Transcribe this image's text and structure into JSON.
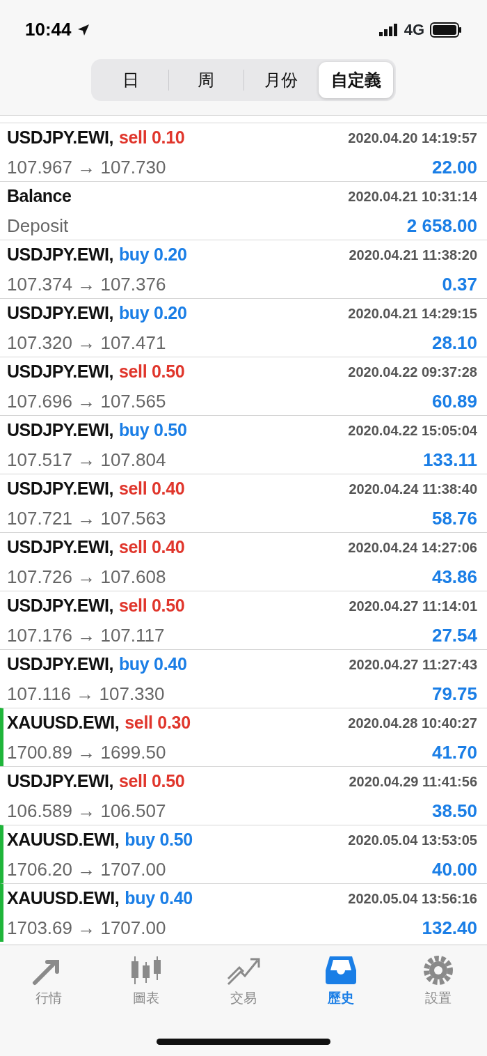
{
  "status_bar": {
    "time": "10:44",
    "network": "4G"
  },
  "segments": [
    {
      "label": "日",
      "selected": false
    },
    {
      "label": "周",
      "selected": false
    },
    {
      "label": "月份",
      "selected": false
    },
    {
      "label": "自定義",
      "selected": true
    }
  ],
  "rows": [
    {
      "kind": "sell",
      "symbol": "USDJPY.EWI,",
      "side": "sell",
      "volume": "0.10",
      "time": "2020.04.20 14:19:57",
      "prices": "107.967 → 107.730",
      "profit": "22.00",
      "marker": false
    },
    {
      "kind": "balance",
      "symbol": "Balance",
      "time": "2020.04.21 10:31:14",
      "prices": "Deposit",
      "profit": "2 658.00",
      "marker": false
    },
    {
      "kind": "buy",
      "symbol": "USDJPY.EWI,",
      "side": "buy",
      "volume": "0.20",
      "time": "2020.04.21 11:38:20",
      "prices": "107.374 → 107.376",
      "profit": "0.37",
      "marker": false
    },
    {
      "kind": "buy",
      "symbol": "USDJPY.EWI,",
      "side": "buy",
      "volume": "0.20",
      "time": "2020.04.21 14:29:15",
      "prices": "107.320 → 107.471",
      "profit": "28.10",
      "marker": false
    },
    {
      "kind": "sell",
      "symbol": "USDJPY.EWI,",
      "side": "sell",
      "volume": "0.50",
      "time": "2020.04.22 09:37:28",
      "prices": "107.696 → 107.565",
      "profit": "60.89",
      "marker": false
    },
    {
      "kind": "buy",
      "symbol": "USDJPY.EWI,",
      "side": "buy",
      "volume": "0.50",
      "time": "2020.04.22 15:05:04",
      "prices": "107.517 → 107.804",
      "profit": "133.11",
      "marker": false
    },
    {
      "kind": "sell",
      "symbol": "USDJPY.EWI,",
      "side": "sell",
      "volume": "0.40",
      "time": "2020.04.24 11:38:40",
      "prices": "107.721 → 107.563",
      "profit": "58.76",
      "marker": false
    },
    {
      "kind": "sell",
      "symbol": "USDJPY.EWI,",
      "side": "sell",
      "volume": "0.40",
      "time": "2020.04.24 14:27:06",
      "prices": "107.726 → 107.608",
      "profit": "43.86",
      "marker": false
    },
    {
      "kind": "sell",
      "symbol": "USDJPY.EWI,",
      "side": "sell",
      "volume": "0.50",
      "time": "2020.04.27 11:14:01",
      "prices": "107.176 → 107.117",
      "profit": "27.54",
      "marker": false
    },
    {
      "kind": "buy",
      "symbol": "USDJPY.EWI,",
      "side": "buy",
      "volume": "0.40",
      "time": "2020.04.27 11:27:43",
      "prices": "107.116 → 107.330",
      "profit": "79.75",
      "marker": false
    },
    {
      "kind": "sell",
      "symbol": "XAUUSD.EWI,",
      "side": "sell",
      "volume": "0.30",
      "time": "2020.04.28 10:40:27",
      "prices": "1700.89 → 1699.50",
      "profit": "41.70",
      "marker": true
    },
    {
      "kind": "sell",
      "symbol": "USDJPY.EWI,",
      "side": "sell",
      "volume": "0.50",
      "time": "2020.04.29 11:41:56",
      "prices": "106.589 → 106.507",
      "profit": "38.50",
      "marker": false
    },
    {
      "kind": "buy",
      "symbol": "XAUUSD.EWI,",
      "side": "buy",
      "volume": "0.50",
      "time": "2020.05.04 13:53:05",
      "prices": "1706.20 → 1707.00",
      "profit": "40.00",
      "marker": true
    },
    {
      "kind": "buy",
      "symbol": "XAUUSD.EWI,",
      "side": "buy",
      "volume": "0.40",
      "time": "2020.05.04 13:56:16",
      "prices": "1703.69 → 1707.00",
      "profit": "132.40",
      "marker": true
    }
  ],
  "tab_bar": [
    {
      "kind": "quotes",
      "label": "行情",
      "selected": false
    },
    {
      "kind": "chart",
      "label": "圖表",
      "selected": false
    },
    {
      "kind": "trade",
      "label": "交易",
      "selected": false
    },
    {
      "kind": "history",
      "label": "歷史",
      "selected": true
    },
    {
      "kind": "settings",
      "label": "設置",
      "selected": false
    }
  ]
}
